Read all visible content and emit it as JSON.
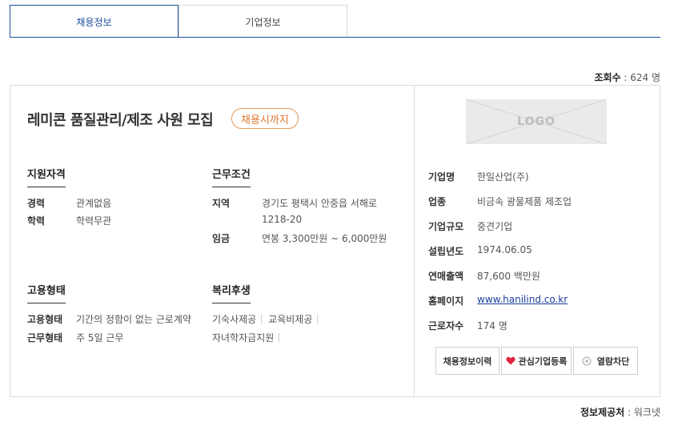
{
  "tabs": [
    {
      "label": "채용정보",
      "active": true
    },
    {
      "label": "기업정보",
      "active": false
    }
  ],
  "views": {
    "label": "조회수",
    "value": "624 명"
  },
  "job": {
    "title": "레미콘 품질관리/제조 사원 모집",
    "deadline_badge": "채용시까지"
  },
  "qualifications": {
    "heading": "지원자격",
    "rows": [
      {
        "label": "경력",
        "value": "관계없음"
      },
      {
        "label": "학력",
        "value": "학력무관"
      }
    ]
  },
  "conditions": {
    "heading": "근무조건",
    "location_label": "지역",
    "location_line1": "경기도 평택시 안중읍 서해로",
    "location_line2": "1218-20",
    "salary_label": "임금",
    "salary_value": "연봉 3,300만원 ~ 6,000만원"
  },
  "employment": {
    "heading": "고용형태",
    "rows": [
      {
        "label": "고용형태",
        "value": "기간의 정함이 없는 근로계약"
      },
      {
        "label": "근무형태",
        "value": "주 5일 근무"
      }
    ]
  },
  "welfare": {
    "heading": "복리후생",
    "items_line1": [
      "기숙사제공",
      "교육비제공"
    ],
    "items_line2": [
      "자녀학자금지원"
    ]
  },
  "company": {
    "logo_text": "LOGO",
    "rows": [
      {
        "label": "기업명",
        "value": "한일산업(주)"
      },
      {
        "label": "업종",
        "value": "비금속 광물제품 제조업"
      },
      {
        "label": "기업규모",
        "value": "중견기업"
      },
      {
        "label": "설립년도",
        "value": "1974.06.05"
      },
      {
        "label": "연매출액",
        "value": "87,600 백만원"
      },
      {
        "label": "홈페이지",
        "value": "www.hanilind.co.kr"
      },
      {
        "label": "근로자수",
        "value": "174 명"
      }
    ]
  },
  "buttons": {
    "history": "채용정보이력",
    "favorite": "관심기업등록",
    "block": "열람차단"
  },
  "colors": {
    "accent": "#1f4f9f",
    "badge": "#e07a2e",
    "heart": "#e0263a"
  },
  "source": {
    "label": "정보제공처",
    "value": "워크넷"
  }
}
